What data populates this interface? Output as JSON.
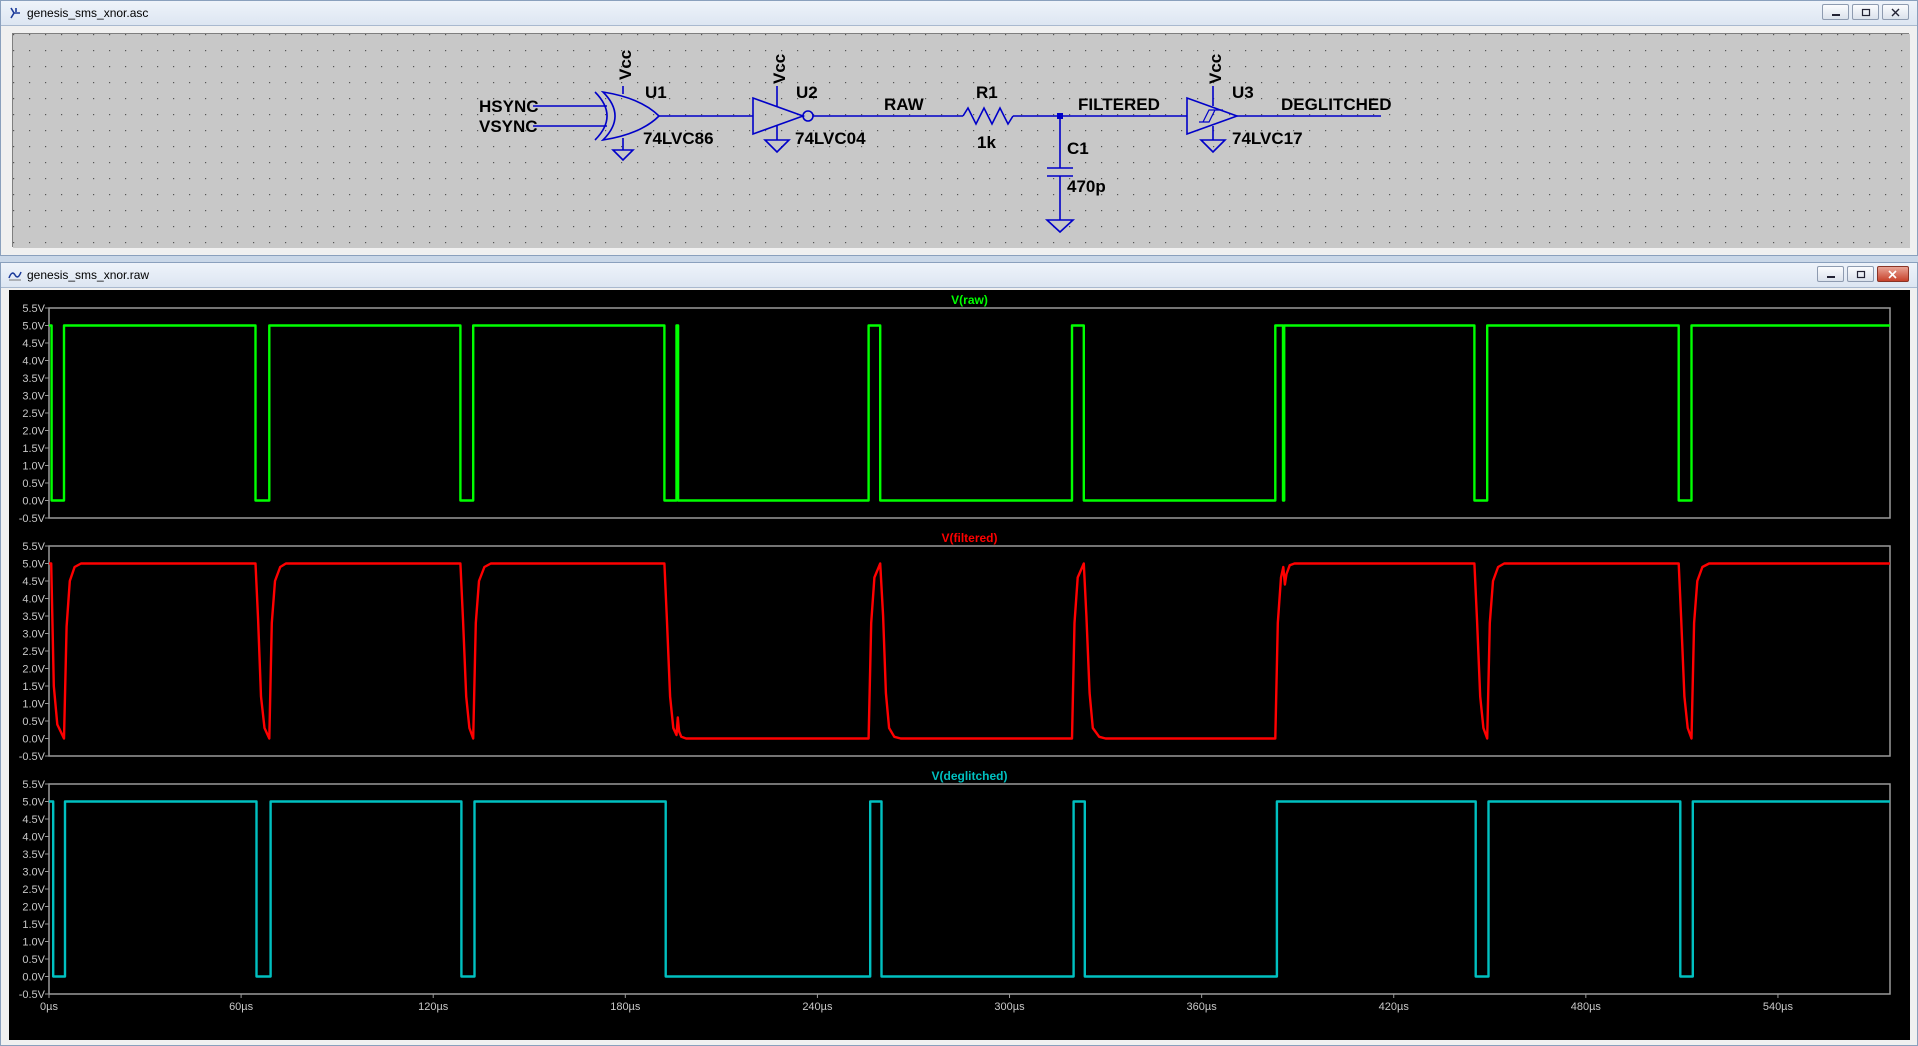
{
  "schematic_window": {
    "title": "genesis_sms_xnor.asc",
    "labels": {
      "vcc_u1": "Vcc",
      "vcc_u2": "Vcc",
      "vcc_u3": "Vcc",
      "hsync": "HSYNC",
      "vsync": "VSYNC",
      "u1_ref": "U1",
      "u1_part": "74LVC86",
      "u2_ref": "U2",
      "u2_part": "74LVC04",
      "raw_net": "RAW",
      "r1_ref": "R1",
      "r1_value": "1k",
      "filtered_net": "FILTERED",
      "c1_ref": "C1",
      "c1_value": "470p",
      "u3_ref": "U3",
      "u3_part": "74LVC17",
      "deglitched_net": "DEGLITCHED"
    }
  },
  "waveform_window": {
    "title": "genesis_sms_xnor.raw"
  },
  "colors": {
    "raw": "#00ff00",
    "filtered": "#ff0000",
    "deglitched": "#00c0c0",
    "wire": "#0000c8",
    "label": "#000000"
  },
  "chart_data": {
    "type": "line",
    "x_unit": "µs",
    "xlim": [
      0,
      575
    ],
    "ylim": [
      -0.5,
      5.5
    ],
    "x_ticks": [
      "0µs",
      "60µs",
      "120µs",
      "180µs",
      "240µs",
      "300µs",
      "360µs",
      "420µs",
      "480µs",
      "540µs"
    ],
    "y_ticks": [
      "5.5V",
      "5.0V",
      "4.5V",
      "4.0V",
      "3.5V",
      "3.0V",
      "2.5V",
      "2.0V",
      "1.5V",
      "1.0V",
      "0.5V",
      "0.0V",
      "-0.5V"
    ],
    "panels": [
      {
        "title": "V(raw)",
        "points": [
          [
            0,
            5
          ],
          [
            0.8,
            5
          ],
          [
            0.8,
            0
          ],
          [
            4.7,
            0
          ],
          [
            4.7,
            5
          ],
          [
            64.5,
            5
          ],
          [
            64.5,
            0
          ],
          [
            68.8,
            0
          ],
          [
            68.8,
            5
          ],
          [
            128.5,
            5
          ],
          [
            128.5,
            0
          ],
          [
            132.5,
            0
          ],
          [
            132.5,
            5
          ],
          [
            192.2,
            5
          ],
          [
            192.2,
            0
          ],
          [
            196,
            0
          ],
          [
            196,
            5
          ],
          [
            196.5,
            5
          ],
          [
            196.5,
            0
          ],
          [
            256,
            0
          ],
          [
            256,
            5
          ],
          [
            259.6,
            5
          ],
          [
            259.6,
            0
          ],
          [
            319.5,
            0
          ],
          [
            319.5,
            5
          ],
          [
            323.2,
            5
          ],
          [
            323.2,
            0
          ],
          [
            383,
            0
          ],
          [
            383,
            5
          ],
          [
            385.4,
            5
          ],
          [
            385.4,
            0
          ],
          [
            385.8,
            0
          ],
          [
            385.8,
            5
          ],
          [
            445.2,
            5
          ],
          [
            445.2,
            0
          ],
          [
            449.2,
            0
          ],
          [
            449.2,
            5
          ],
          [
            509,
            5
          ],
          [
            509,
            0
          ],
          [
            513,
            0
          ],
          [
            513,
            5
          ],
          [
            575,
            5
          ]
        ]
      },
      {
        "title": "V(filtered)",
        "points": [
          [
            0,
            5
          ],
          [
            0.7,
            5
          ],
          [
            1.5,
            1.5
          ],
          [
            2.6,
            0.4
          ],
          [
            4.7,
            0
          ],
          [
            5.5,
            3.2
          ],
          [
            6.5,
            4.5
          ],
          [
            8,
            4.9
          ],
          [
            10,
            5
          ],
          [
            64.5,
            5
          ],
          [
            65.3,
            3.4
          ],
          [
            66.2,
            1.2
          ],
          [
            67.3,
            0.3
          ],
          [
            68.8,
            0
          ],
          [
            69.6,
            3.3
          ],
          [
            70.6,
            4.5
          ],
          [
            72.2,
            4.9
          ],
          [
            74,
            5
          ],
          [
            128.5,
            5
          ],
          [
            129.3,
            3.4
          ],
          [
            130.3,
            1.2
          ],
          [
            131.3,
            0.3
          ],
          [
            132.5,
            0
          ],
          [
            133.3,
            3.3
          ],
          [
            134.3,
            4.5
          ],
          [
            136,
            4.9
          ],
          [
            138,
            5
          ],
          [
            192.2,
            5
          ],
          [
            193,
            3.4
          ],
          [
            194,
            1.2
          ],
          [
            195,
            0.3
          ],
          [
            196,
            0.1
          ],
          [
            196.4,
            0.6
          ],
          [
            196.8,
            0.2
          ],
          [
            197.5,
            0.05
          ],
          [
            199,
            0
          ],
          [
            256,
            0
          ],
          [
            256.8,
            3.3
          ],
          [
            257.8,
            4.6
          ],
          [
            259.6,
            5
          ],
          [
            260.5,
            3.5
          ],
          [
            261.4,
            1.3
          ],
          [
            262.4,
            0.3
          ],
          [
            264,
            0.05
          ],
          [
            266,
            0
          ],
          [
            319.5,
            0
          ],
          [
            320.3,
            3.3
          ],
          [
            321.3,
            4.6
          ],
          [
            323.2,
            5
          ],
          [
            324,
            3.5
          ],
          [
            325,
            1.3
          ],
          [
            326,
            0.3
          ],
          [
            328,
            0.05
          ],
          [
            330,
            0
          ],
          [
            383,
            0
          ],
          [
            383.8,
            3.3
          ],
          [
            384.8,
            4.6
          ],
          [
            385.5,
            4.9
          ],
          [
            386,
            4.4
          ],
          [
            386.5,
            4.7
          ],
          [
            387.5,
            4.95
          ],
          [
            389,
            5
          ],
          [
            445.2,
            5
          ],
          [
            446,
            3.4
          ],
          [
            447,
            1.2
          ],
          [
            448,
            0.3
          ],
          [
            449.2,
            0
          ],
          [
            450,
            3.3
          ],
          [
            451,
            4.5
          ],
          [
            452.6,
            4.9
          ],
          [
            454.5,
            5
          ],
          [
            509,
            5
          ],
          [
            509.8,
            3.4
          ],
          [
            510.8,
            1.2
          ],
          [
            511.8,
            0.3
          ],
          [
            513,
            0
          ],
          [
            513.8,
            3.3
          ],
          [
            514.8,
            4.5
          ],
          [
            516.4,
            4.9
          ],
          [
            518.5,
            5
          ],
          [
            575,
            5
          ]
        ]
      },
      {
        "title": "V(deglitched)",
        "points": [
          [
            0,
            5
          ],
          [
            1.3,
            5
          ],
          [
            1.3,
            0
          ],
          [
            5,
            0
          ],
          [
            5,
            5
          ],
          [
            64.8,
            5
          ],
          [
            64.8,
            0
          ],
          [
            69.2,
            0
          ],
          [
            69.2,
            5
          ],
          [
            128.8,
            5
          ],
          [
            128.8,
            0
          ],
          [
            132.9,
            0
          ],
          [
            132.9,
            5
          ],
          [
            192.6,
            5
          ],
          [
            192.6,
            0
          ],
          [
            256.5,
            0
          ],
          [
            256.5,
            5
          ],
          [
            260,
            5
          ],
          [
            260,
            0
          ],
          [
            320,
            0
          ],
          [
            320,
            5
          ],
          [
            323.5,
            5
          ],
          [
            323.5,
            0
          ],
          [
            383.5,
            0
          ],
          [
            383.5,
            5
          ],
          [
            445.6,
            5
          ],
          [
            445.6,
            0
          ],
          [
            449.6,
            0
          ],
          [
            449.6,
            5
          ],
          [
            509.5,
            5
          ],
          [
            509.5,
            0
          ],
          [
            513.4,
            0
          ],
          [
            513.4,
            5
          ],
          [
            575,
            5
          ]
        ]
      }
    ]
  }
}
